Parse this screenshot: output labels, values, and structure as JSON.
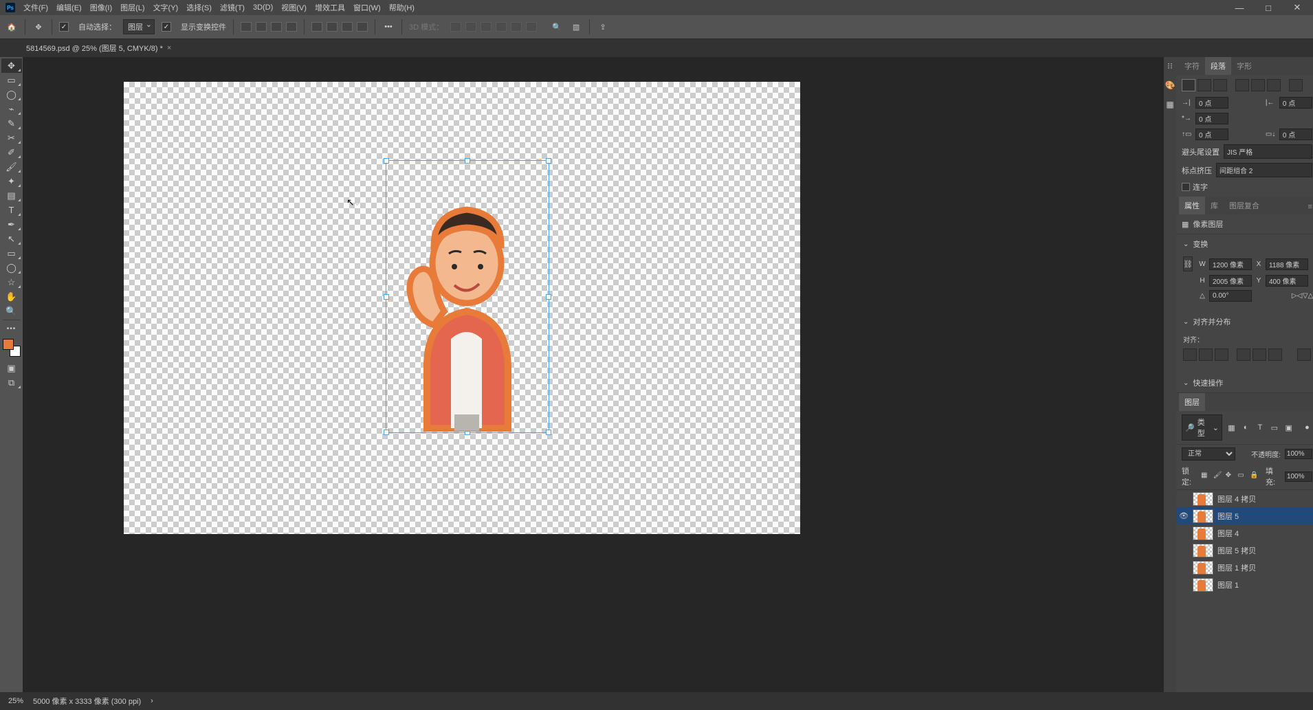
{
  "menu": {
    "file": "文件(F)",
    "edit": "编辑(E)",
    "image": "图像(I)",
    "layer": "图层(L)",
    "type": "文字(Y)",
    "select": "选择(S)",
    "filter": "滤镜(T)",
    "three_d": "3D(D)",
    "view": "视图(V)",
    "plugins": "增效工具",
    "window": "窗口(W)",
    "help": "帮助(H)"
  },
  "option": {
    "auto_select": "自动选择：",
    "auto_select_target": "图层",
    "show_transform": "显示变换控件",
    "three_d_mode": "3D 模式："
  },
  "tab": {
    "title": "5814569.psd @ 25% (图层 5, CMYK/8) *"
  },
  "panels": {
    "char": "字符",
    "para": "段落",
    "glyph": "字形",
    "indent_left": "0 点",
    "indent_right": "0 点",
    "indent_first": "0 点",
    "space_before": "0 点",
    "space_after": "0 点",
    "kinsoku_label": "避头尾设置",
    "kinsoku_val": "JIS 严格",
    "mojikumi_label": "标点挤压",
    "mojikumi_val": "间距组合 2",
    "hyphenate": "连字",
    "props": "属性",
    "libs": "库",
    "comps": "图层复合",
    "pixel_layer": "像素图层",
    "transform": "变换",
    "w": "1200 像素",
    "x": "1188 像素",
    "h": "2005 像素",
    "y": "400 像素",
    "angle": "0.00°",
    "align_dist": "对齐并分布",
    "align_label": "对齐：",
    "quick": "快速操作",
    "layers": "图层",
    "kind": "类型",
    "blend": "正常",
    "opacity_label": "不透明度:",
    "opacity": "100%",
    "lock_label": "锁定:",
    "fill_label": "填充:",
    "fill": "100%"
  },
  "layers": [
    {
      "name": "图层 4 拷贝",
      "vis": false,
      "sel": false
    },
    {
      "name": "图层 5",
      "vis": true,
      "sel": true
    },
    {
      "name": "图层 4",
      "vis": false,
      "sel": false
    },
    {
      "name": "图层 5 拷贝",
      "vis": false,
      "sel": false
    },
    {
      "name": "图层 1 拷贝",
      "vis": false,
      "sel": false
    },
    {
      "name": "图层 1",
      "vis": false,
      "sel": false
    }
  ],
  "status": {
    "zoom": "25%",
    "docinfo": "5000 像素 x 3333 像素 (300 ppi)"
  }
}
